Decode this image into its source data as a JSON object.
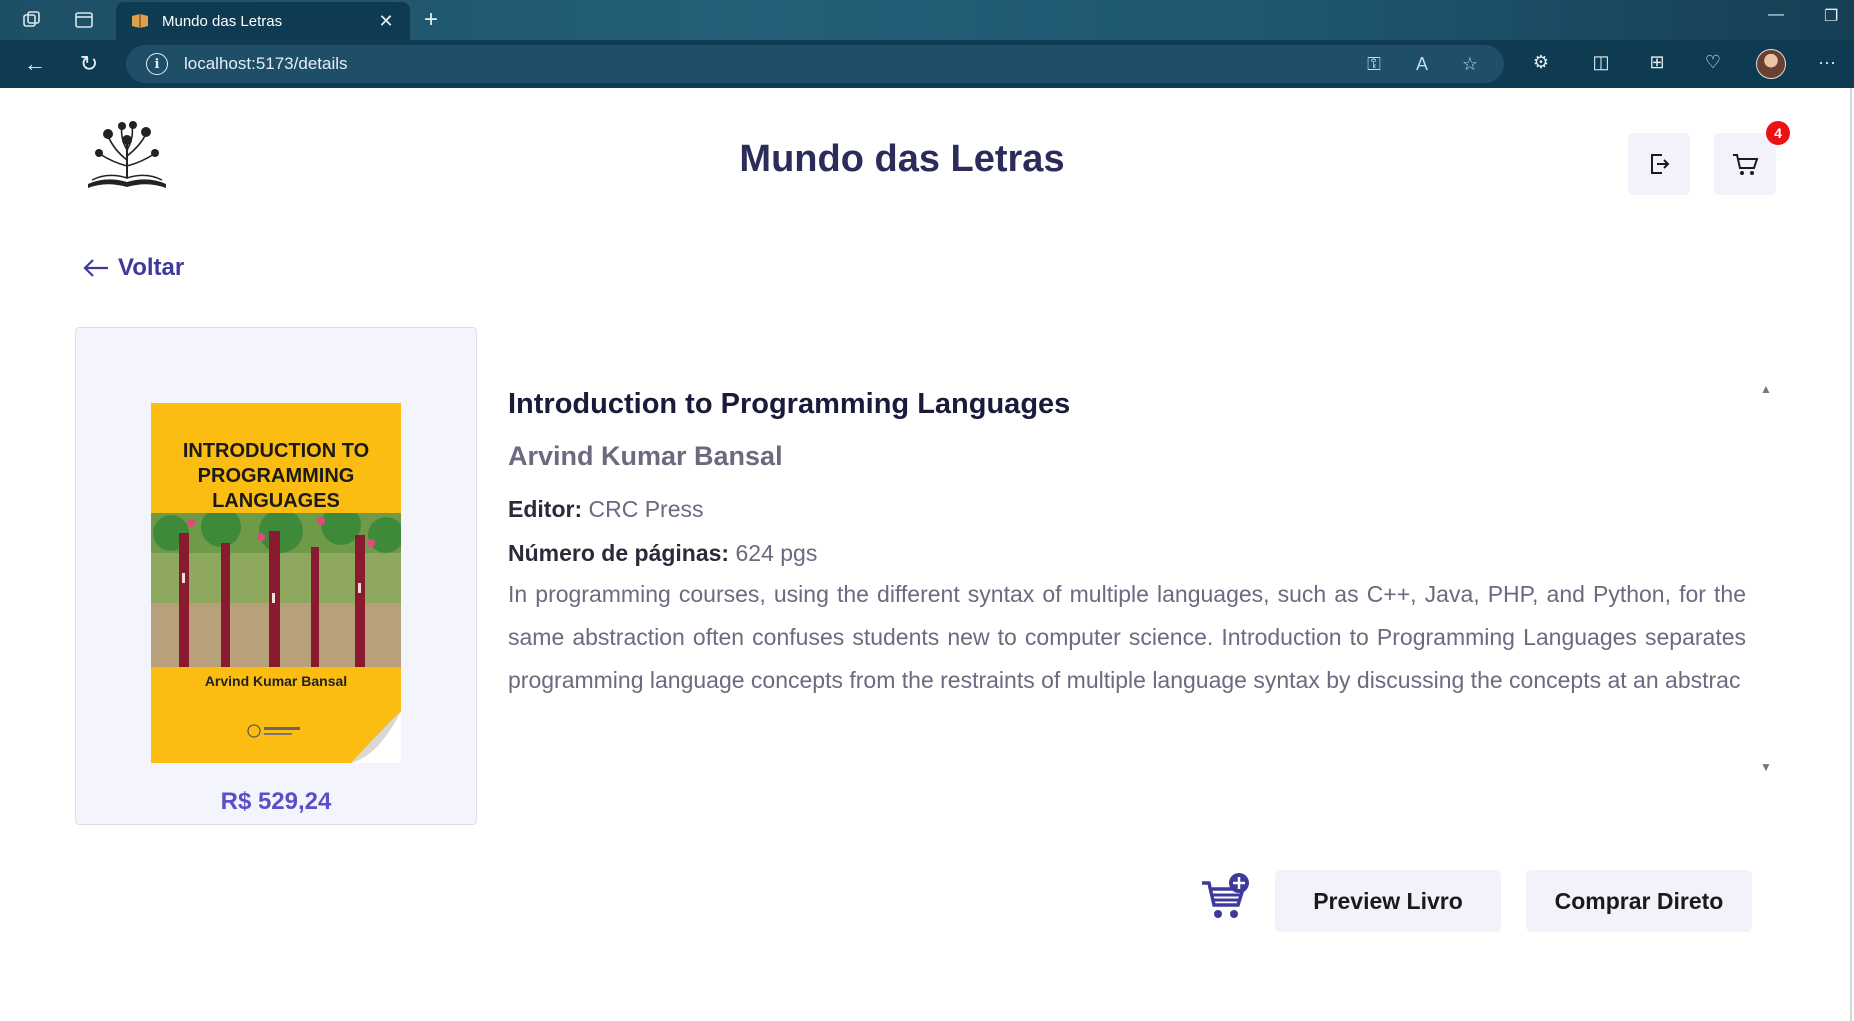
{
  "browser": {
    "tab_title": "Mundo das Letras",
    "url": "localhost:5173/details"
  },
  "header": {
    "site_title": "Mundo das Letras",
    "cart_count": "4"
  },
  "back_link": {
    "label": "Voltar"
  },
  "book": {
    "cover_title": "INTRODUCTION TO PROGRAMMING LANGUAGES",
    "cover_author": "Arvind Kumar Bansal",
    "price": "R$ 529,24",
    "title": "Introduction to Programming Languages",
    "author": "Arvind Kumar Bansal",
    "editor_label": "Editor:",
    "editor": "CRC Press",
    "pages_label": "Número de páginas:",
    "pages": "624 pgs",
    "description": "In programming courses, using the different syntax of multiple languages, such as C++, Java, PHP, and Python, for the same abstraction often confuses students new to computer science. Introduction to Programming Languages separates programming language concepts from the restraints of multiple language syntax by discussing the concepts at an abstrac"
  },
  "actions": {
    "preview_label": "Preview Livro",
    "buy_label": "Comprar Direto"
  },
  "colors": {
    "accent": "#3e3a9c",
    "price": "#5a4fc8",
    "badge": "#ee1111"
  }
}
